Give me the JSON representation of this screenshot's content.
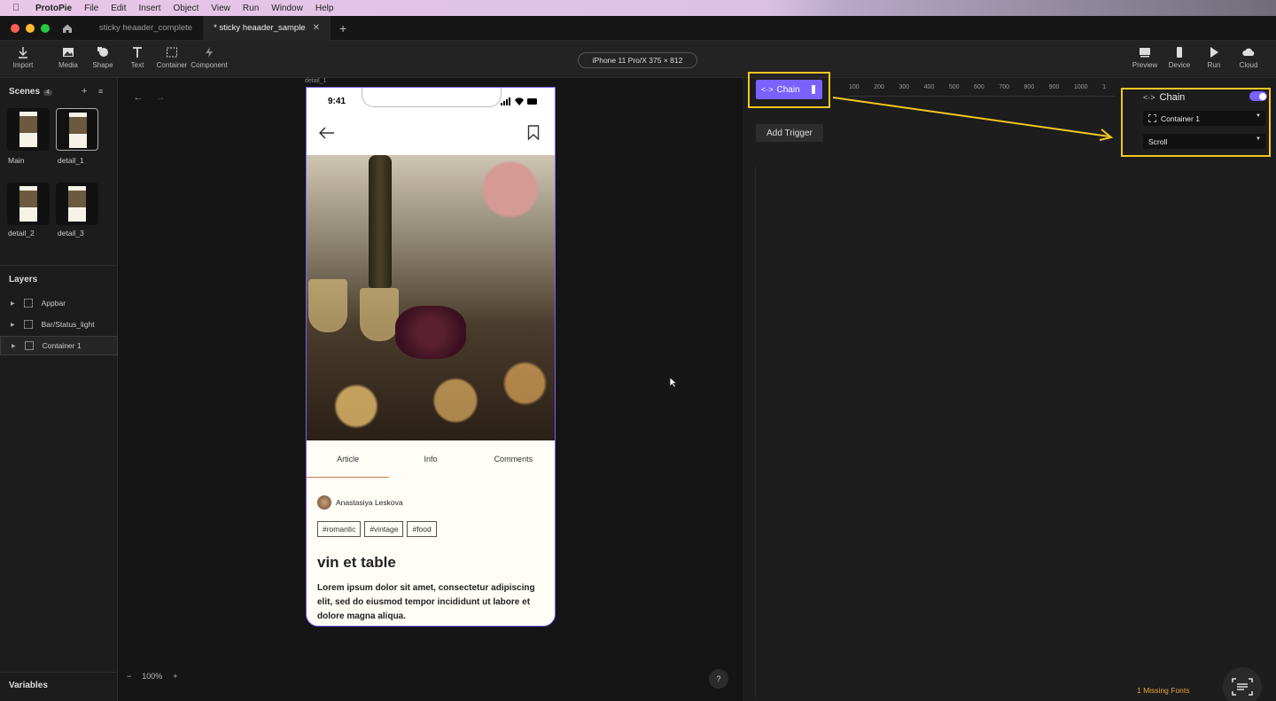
{
  "menubar": {
    "app_name": "ProtoPie",
    "items": [
      "File",
      "Edit",
      "Insert",
      "Object",
      "View",
      "Run",
      "Window",
      "Help"
    ]
  },
  "tabs": [
    {
      "label": "sticky heaader_complete",
      "active": false
    },
    {
      "label": "* sticky heaader_sample",
      "active": true,
      "close": "✕"
    }
  ],
  "toolbar": {
    "left_tools": [
      "Import",
      "Media",
      "Shape",
      "Text",
      "Container",
      "Component"
    ],
    "device": "iPhone 11 Pro/X  375 × 812",
    "right_tools": [
      "Preview",
      "Device",
      "Run",
      "Cloud"
    ]
  },
  "scenes": {
    "title": "Scenes",
    "count": "4",
    "items": [
      "Main",
      "detail_1",
      "detail_2",
      "detail_3"
    ]
  },
  "layers": {
    "title": "Layers",
    "items": [
      "Appbar",
      "Bar/Status_light",
      "Container 1"
    ]
  },
  "variables_title": "Variables",
  "canvas": {
    "frame_label": "detail_1",
    "zoom": "100%",
    "zoom_minus": "−",
    "zoom_plus": "+",
    "help": "?"
  },
  "phone": {
    "time": "9:41",
    "tabs": [
      "Article",
      "Info",
      "Comments"
    ],
    "author": "Anastasiya Leskova",
    "tags": [
      "#romantic",
      "#vintage",
      "#food"
    ],
    "title": "vin et table",
    "body": "Lorem ipsum dolor sit amet, consectetur adipiscing elit, sed do eiusmod tempor incididunt ut labore et dolore magna aliqua."
  },
  "interaction": {
    "chain_label": "Chain",
    "add_trigger": "Add Trigger",
    "ruler": [
      "100",
      "200",
      "300",
      "400",
      "500",
      "600",
      "700",
      "800",
      "900",
      "1000",
      "1"
    ],
    "props_title": "Chain",
    "container_select": "Container 1",
    "type_select": "Scroll",
    "missing_fonts": "1 Missing Fonts"
  },
  "colors": {
    "accent": "#7b61ff",
    "highlight": "#f3c623",
    "warning": "#e9a23b"
  }
}
